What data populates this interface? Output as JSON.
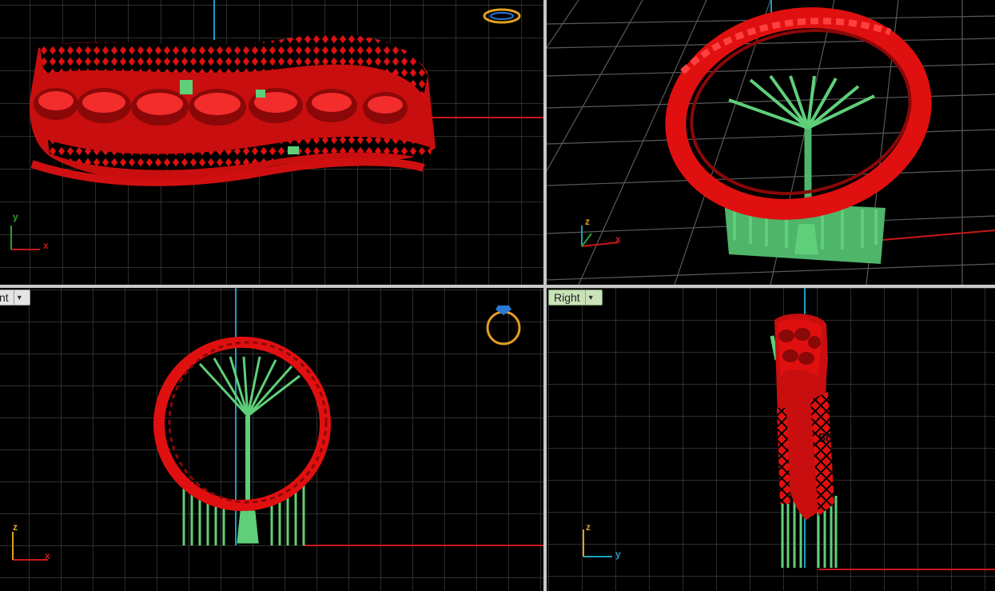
{
  "viewports": {
    "top": {
      "x_label": "x",
      "y_label": "y"
    },
    "perspective": {
      "x_label": "x",
      "z_label": "z"
    },
    "front": {
      "tab_label": "nt",
      "x_label": "x",
      "z_label": "z"
    },
    "right": {
      "tab_label": "Right",
      "z_label": "z",
      "y_label": "y",
      "engraving": "50"
    }
  },
  "colors": {
    "viewport_bg": "#000000",
    "grid": "#4a4a4a",
    "grid_major": "#6e6e6e",
    "model": "#e01010",
    "supports": "#5fcf7a",
    "axis_red": "#c81818",
    "axis_blue": "#1aa0c0",
    "axis_green": "#2aa02a",
    "widget": "#e0a020",
    "widget_gem": "#2a7ad8"
  },
  "icons": [
    "ring-gem-widget-icon",
    "dropdown-arrow-icon"
  ]
}
